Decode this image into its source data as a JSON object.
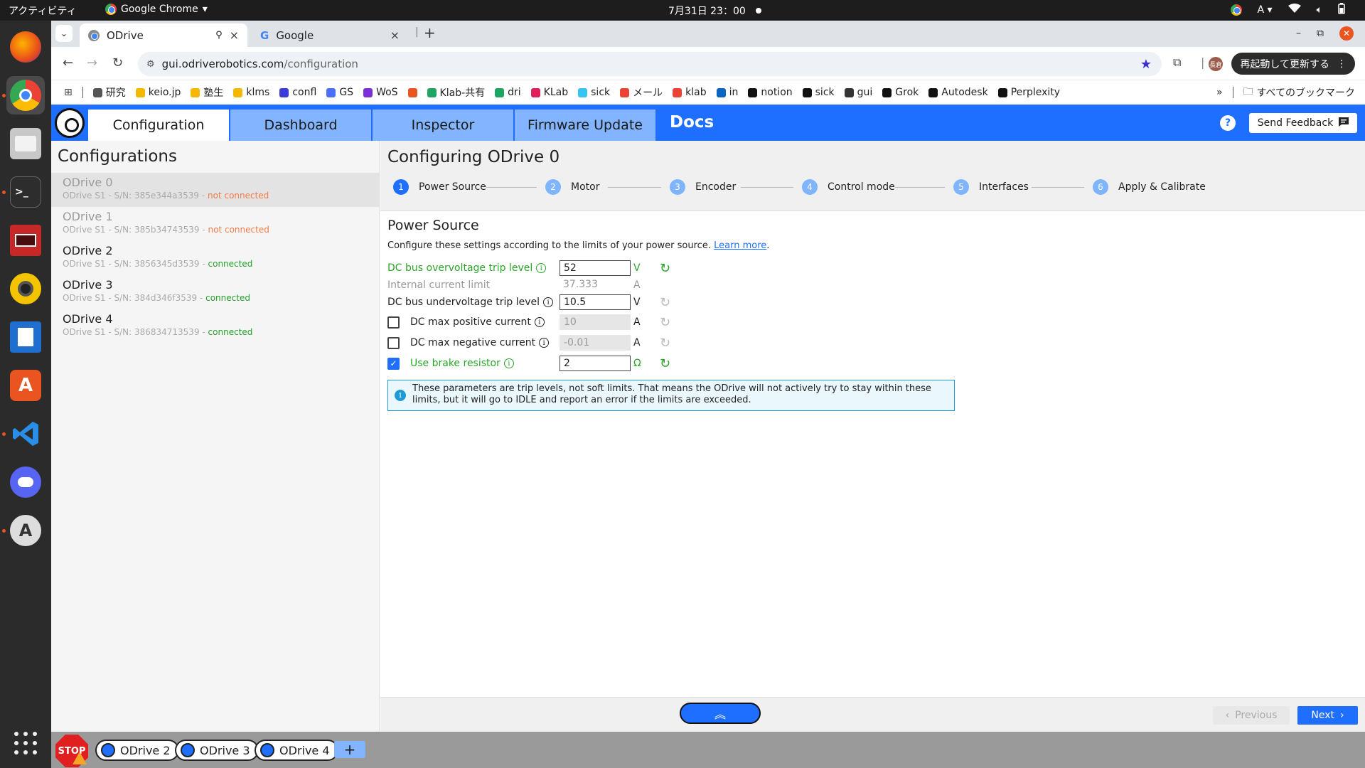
{
  "system": {
    "activities": "アクティビティ",
    "app_name": "Google Chrome",
    "clock": "7月31日  23：00",
    "input_method": "A"
  },
  "browser": {
    "tabs": [
      {
        "title": "ODrive",
        "active": true
      },
      {
        "title": "Google",
        "active": false
      }
    ],
    "url_host": "gui.odriverobotics.com",
    "url_path": "/configuration",
    "relaunch_label": "再起動して更新する",
    "profile_initials": "長倉",
    "bookmarks": [
      {
        "label": "研究",
        "icon": "folder-icon",
        "color": "#555555"
      },
      {
        "label": "keio.jp",
        "icon": "keio-icon",
        "color": "#f5b800"
      },
      {
        "label": "塾生",
        "icon": "keio-icon",
        "color": "#f5b800"
      },
      {
        "label": "klms",
        "icon": "keio-icon",
        "color": "#f5b800"
      },
      {
        "label": "confl",
        "icon": "confluence-icon",
        "color": "#3b3bd9"
      },
      {
        "label": "GS",
        "icon": "scholar-icon",
        "color": "#4a6ef5"
      },
      {
        "label": "WoS",
        "icon": "wos-icon",
        "color": "#7b2fd9"
      },
      {
        "label": "",
        "icon": "gear-bookmark-icon",
        "color": "#e95420"
      },
      {
        "label": "Klab-共有",
        "icon": "drive-icon",
        "color": "#1fa463"
      },
      {
        "label": "dri",
        "icon": "drive-icon",
        "color": "#1fa463"
      },
      {
        "label": "KLab",
        "icon": "slack-icon",
        "color": "#e01e5a"
      },
      {
        "label": "sick",
        "icon": "slack-icon",
        "color": "#36c5f0"
      },
      {
        "label": "メール",
        "icon": "gmail-icon",
        "color": "#ea4335"
      },
      {
        "label": "klab",
        "icon": "gmail-icon",
        "color": "#ea4335"
      },
      {
        "label": "in",
        "icon": "linkedin-icon",
        "color": "#0a66c2"
      },
      {
        "label": "notion",
        "icon": "notion-icon",
        "color": "#111111"
      },
      {
        "label": "sick",
        "icon": "github-icon",
        "color": "#111111"
      },
      {
        "label": "gui",
        "icon": "globe-icon",
        "color": "#333333"
      },
      {
        "label": "Grok",
        "icon": "grok-icon",
        "color": "#111111"
      },
      {
        "label": "Autodesk",
        "icon": "autodesk-icon",
        "color": "#111111"
      },
      {
        "label": "Perplexity",
        "icon": "perplexity-icon",
        "color": "#111111"
      }
    ],
    "all_bookmarks_label": "すべてのブックマーク"
  },
  "app": {
    "tabs": [
      "Configuration",
      "Dashboard",
      "Inspector",
      "Firmware Update"
    ],
    "docs_label": "Docs",
    "help_label": "?",
    "feedback_label": "Send Feedback"
  },
  "sidebar": {
    "title": "Configurations",
    "devices": [
      {
        "name": "ODrive 0",
        "sub": "ODrive S1  - S/N: 385e344a3539 - ",
        "status": "not connected",
        "ok": false,
        "selected": true
      },
      {
        "name": "ODrive 1",
        "sub": "ODrive S1  - S/N: 385b34743539 - ",
        "status": "not connected",
        "ok": false,
        "selected": false
      },
      {
        "name": "ODrive 2",
        "sub": "ODrive S1  - S/N: 3856345d3539 - ",
        "status": "connected",
        "ok": true,
        "selected": false
      },
      {
        "name": "ODrive 3",
        "sub": "ODrive S1  - S/N: 384d346f3539 - ",
        "status": "connected",
        "ok": true,
        "selected": false
      },
      {
        "name": "ODrive 4",
        "sub": "ODrive S1  - S/N: 386834713539 - ",
        "status": "connected",
        "ok": true,
        "selected": false
      }
    ]
  },
  "main": {
    "title": "Configuring ODrive 0",
    "steps": [
      {
        "num": "1",
        "label": "Power Source"
      },
      {
        "num": "2",
        "label": "Motor"
      },
      {
        "num": "3",
        "label": "Encoder"
      },
      {
        "num": "4",
        "label": "Control mode"
      },
      {
        "num": "5",
        "label": "Interfaces"
      },
      {
        "num": "6",
        "label": "Apply & Calibrate"
      }
    ],
    "section_title": "Power Source",
    "description": "Configure these settings according to the limits of your power source.",
    "learn_more": "Learn more",
    "fields": {
      "overvoltage": {
        "label": "DC bus overvoltage trip level",
        "value": "52",
        "unit": "V"
      },
      "internal_current": {
        "label": "Internal current limit",
        "value": "37.333",
        "unit": "A"
      },
      "undervoltage": {
        "label": "DC bus undervoltage trip level",
        "value": "10.5",
        "unit": "V"
      },
      "max_pos_current": {
        "label": "DC max positive current",
        "value": "10",
        "unit": "A",
        "checked": false
      },
      "max_neg_current": {
        "label": "DC max negative current",
        "value": "-0.01",
        "unit": "A",
        "checked": false
      },
      "brake_resistor": {
        "label": "Use brake resistor",
        "value": "2",
        "unit": "Ω",
        "checked": true
      }
    },
    "notice": "These parameters are trip levels, not soft limits. That means the ODrive will not actively try to stay within these limits, but it will go to IDLE and report an error if the limits are exceeded."
  },
  "footer": {
    "previous": "Previous",
    "next": "Next"
  },
  "bottom": {
    "stop_label": "STOP",
    "devices": [
      "ODrive 2",
      "ODrive 3",
      "ODrive 4"
    ],
    "add_label": "+"
  },
  "colors": {
    "accent": "#1e6fff",
    "ok": "#2aa52a",
    "error": "#f07c4a"
  }
}
